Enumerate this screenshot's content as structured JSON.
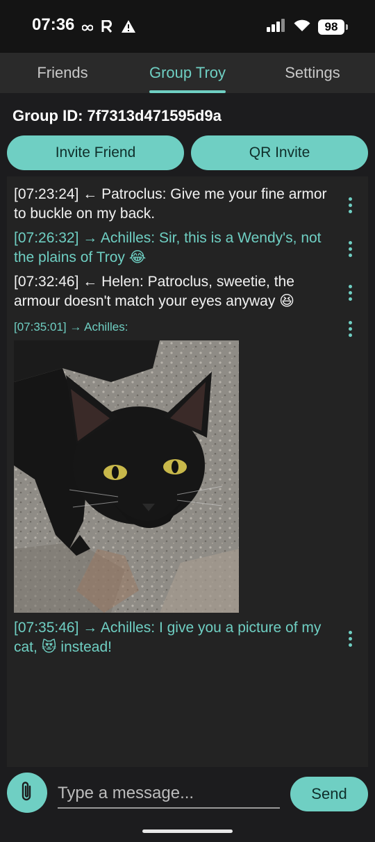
{
  "status_bar": {
    "time": "07:36",
    "left_icons": [
      "infinity-icon",
      "r-icon",
      "warning-icon"
    ],
    "right_icons": [
      "signal-icon",
      "wifi-icon"
    ],
    "battery": "98"
  },
  "tabs": [
    {
      "label": "Friends",
      "active": false
    },
    {
      "label": "Group Troy",
      "active": true
    },
    {
      "label": "Settings",
      "active": false
    }
  ],
  "group": {
    "id_label": "Group ID: 7f7313d471595d9a"
  },
  "actions": {
    "invite_friend": "Invite Friend",
    "qr_invite": "QR Invite"
  },
  "messages": [
    {
      "text": "[07:23:24] ← Patroclus: Give me your fine armor to buckle on my back.",
      "direction": "in"
    },
    {
      "text": "[07:26:32] → Achilles: Sir, this is a Wendy's, not the plains of Troy 😂",
      "direction": "out"
    },
    {
      "text": "[07:32:46] ← Helen: Patroclus, sweetie, the armour doesn't match your eyes anyway 😆",
      "direction": "in"
    },
    {
      "text": "[07:35:01] → Achilles:",
      "direction": "out",
      "has_image": true,
      "image": "black-cat-photo"
    },
    {
      "text": "[07:35:46] → Achilles: I give you a picture of my cat, 😻 instead!",
      "direction": "out"
    }
  ],
  "composer": {
    "placeholder": "Type a message...",
    "value": "",
    "send_label": "Send"
  },
  "colors": {
    "accent": "#6fcfc3",
    "background": "#1c1c1e",
    "chat_background": "#232323",
    "tab_bar": "#2a2a2a"
  }
}
